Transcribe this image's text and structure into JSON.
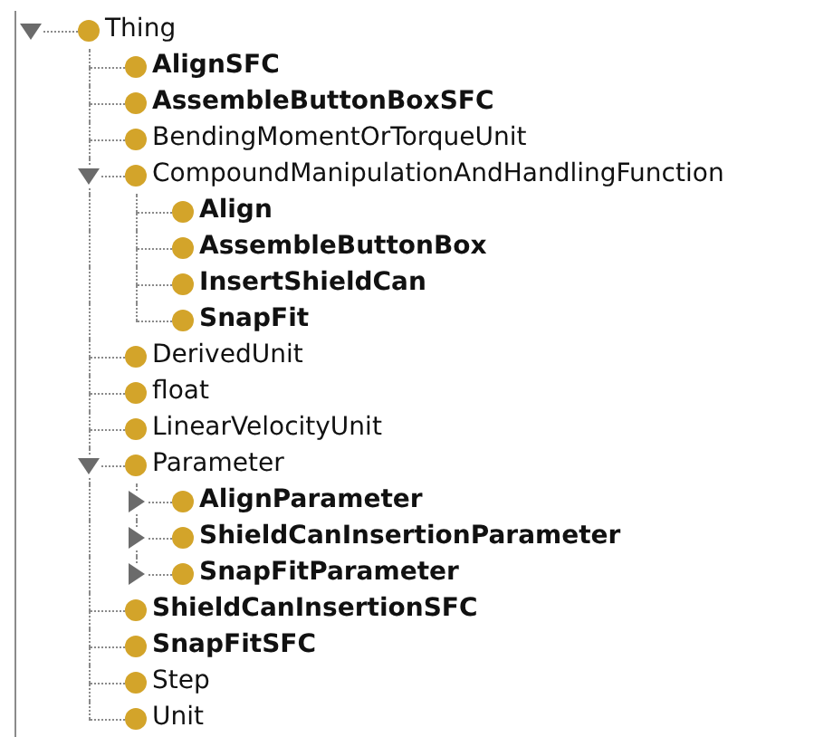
{
  "tree": {
    "label": "Thing",
    "bold": false,
    "expanded": true,
    "children": [
      {
        "label": "AlignSFC",
        "bold": true
      },
      {
        "label": "AssembleButtonBoxSFC",
        "bold": true
      },
      {
        "label": "BendingMomentOrTorqueUnit",
        "bold": false
      },
      {
        "label": "CompoundManipulationAndHandlingFunction",
        "bold": false,
        "expanded": true,
        "children": [
          {
            "label": "Align",
            "bold": true
          },
          {
            "label": "AssembleButtonBox",
            "bold": true
          },
          {
            "label": "InsertShieldCan",
            "bold": true
          },
          {
            "label": "SnapFit",
            "bold": true
          }
        ]
      },
      {
        "label": "DerivedUnit",
        "bold": false
      },
      {
        "label": "float",
        "bold": false
      },
      {
        "label": "LinearVelocityUnit",
        "bold": false
      },
      {
        "label": "Parameter",
        "bold": false,
        "expanded": true,
        "children": [
          {
            "label": "AlignParameter",
            "bold": true,
            "expanded": false
          },
          {
            "label": "ShieldCanInsertionParameter",
            "bold": true,
            "expanded": false
          },
          {
            "label": "SnapFitParameter",
            "bold": true,
            "expanded": false
          }
        ]
      },
      {
        "label": "ShieldCanInsertionSFC",
        "bold": true
      },
      {
        "label": "SnapFitSFC",
        "bold": true
      },
      {
        "label": "Step",
        "bold": false
      },
      {
        "label": "Unit",
        "bold": false
      }
    ]
  }
}
